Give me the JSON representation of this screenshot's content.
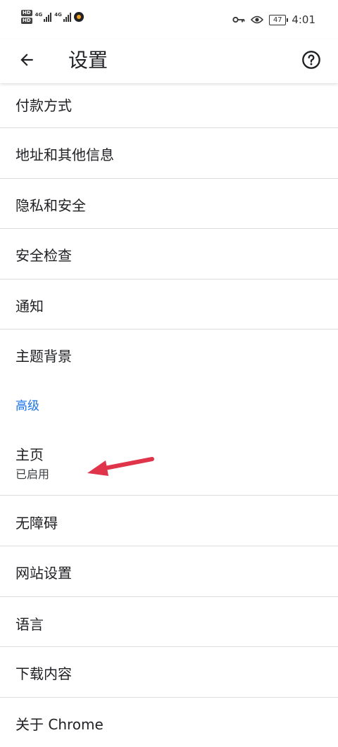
{
  "status_bar": {
    "left": {
      "hd_badges": [
        "HD",
        "HD"
      ],
      "network_tags": [
        "4G",
        "4G"
      ]
    },
    "right": {
      "icons": [
        "key-icon",
        "eye-icon"
      ],
      "battery": "47",
      "time": "4:01"
    }
  },
  "toolbar": {
    "title": "设置",
    "back_icon": "arrow-left-icon",
    "help_icon": "help-circle-icon"
  },
  "items": [
    {
      "title": "付款方式"
    },
    {
      "title": "地址和其他信息"
    },
    {
      "title": "隐私和安全"
    },
    {
      "title": "安全检查"
    },
    {
      "title": "通知"
    },
    {
      "title": "主题背景"
    }
  ],
  "section": {
    "label": "高级"
  },
  "advanced_items": [
    {
      "title": "主页",
      "subtitle": "已启用"
    },
    {
      "title": "无障碍"
    },
    {
      "title": "网站设置"
    },
    {
      "title": "语言"
    },
    {
      "title": "下载内容"
    },
    {
      "title": "关于 Chrome"
    }
  ],
  "colors": {
    "accent": "#1a73e8",
    "divider": "#dadce0",
    "annotation_arrow": "#e0344a"
  }
}
